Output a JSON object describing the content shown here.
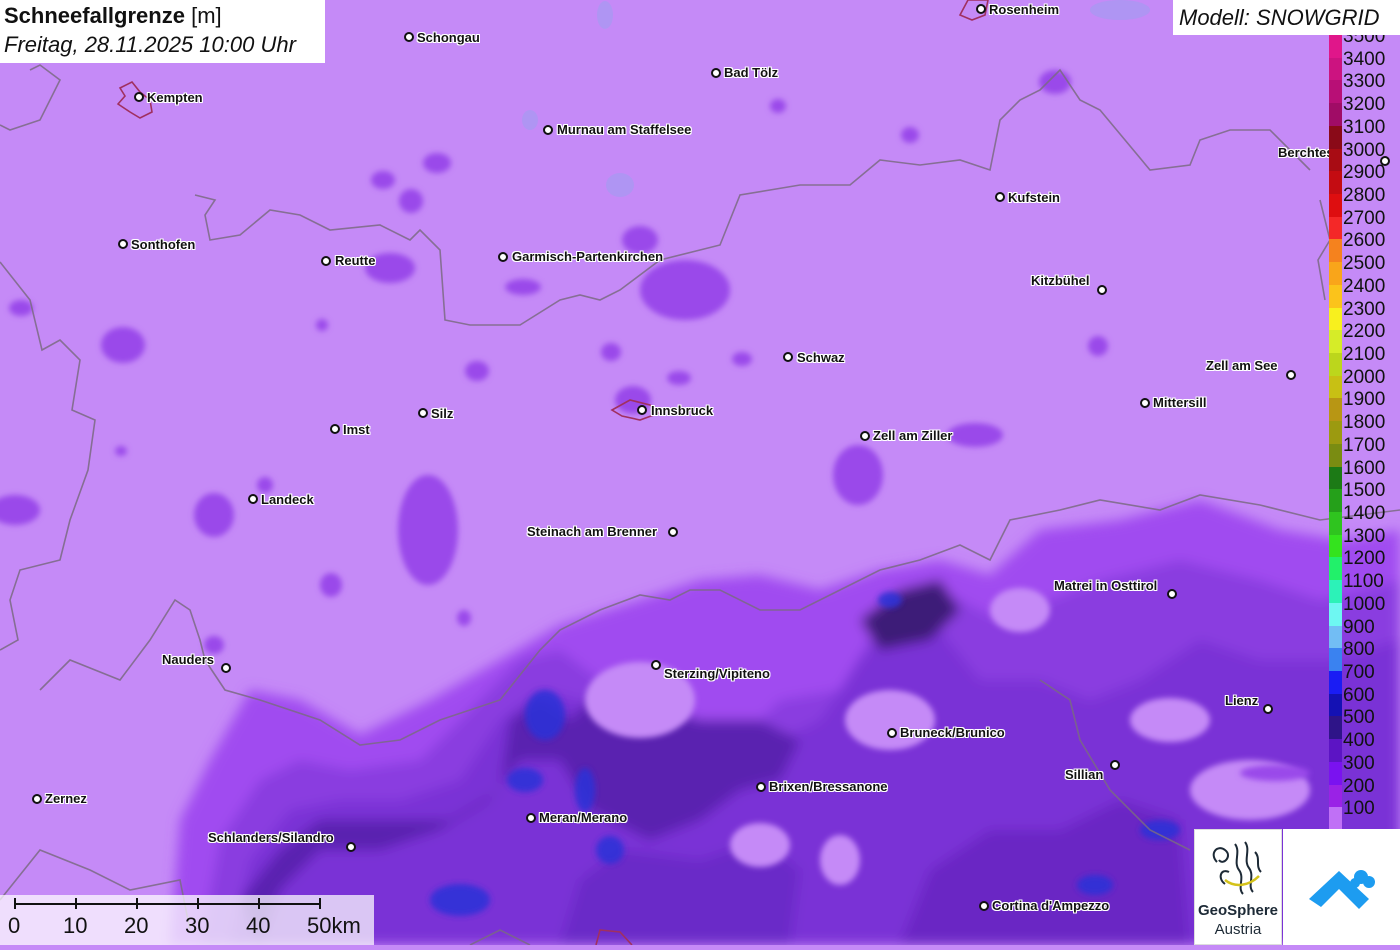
{
  "title": {
    "main": "Schneefallgrenze",
    "unit": "[m]",
    "datetime": "Freitag, 28.11.2025 10:00 Uhr"
  },
  "model": "Modell: SNOWGRID",
  "legend": {
    "items": [
      {
        "label": "3500",
        "color": "#e0168a"
      },
      {
        "label": "3400",
        "color": "#cc1380"
      },
      {
        "label": "3300",
        "color": "#b80f76"
      },
      {
        "label": "3200",
        "color": "#a00c66"
      },
      {
        "label": "3100",
        "color": "#8a0a18"
      },
      {
        "label": "3000",
        "color": "#a80c14"
      },
      {
        "label": "2900",
        "color": "#c40c12"
      },
      {
        "label": "2800",
        "color": "#de0e10"
      },
      {
        "label": "2700",
        "color": "#f42828"
      },
      {
        "label": "2600",
        "color": "#f5821e"
      },
      {
        "label": "2500",
        "color": "#f9a51a"
      },
      {
        "label": "2400",
        "color": "#fbc31b"
      },
      {
        "label": "2300",
        "color": "#f8f01e"
      },
      {
        "label": "2200",
        "color": "#d6ec28"
      },
      {
        "label": "2100",
        "color": "#bcd61c"
      },
      {
        "label": "2000",
        "color": "#c8c014"
      },
      {
        "label": "1900",
        "color": "#b89614"
      },
      {
        "label": "1800",
        "color": "#9c9a10"
      },
      {
        "label": "1700",
        "color": "#7a8c12"
      },
      {
        "label": "1600",
        "color": "#1c7a16"
      },
      {
        "label": "1500",
        "color": "#25a01a"
      },
      {
        "label": "1400",
        "color": "#2fc41f"
      },
      {
        "label": "1300",
        "color": "#34e31e"
      },
      {
        "label": "1200",
        "color": "#22f06a"
      },
      {
        "label": "1100",
        "color": "#2cf2b8"
      },
      {
        "label": "1000",
        "color": "#6ef7f2"
      },
      {
        "label": "900",
        "color": "#72bdf4"
      },
      {
        "label": "800",
        "color": "#3a82f0"
      },
      {
        "label": "700",
        "color": "#1a1cf4"
      },
      {
        "label": "600",
        "color": "#1411b4"
      },
      {
        "label": "500",
        "color": "#2e1488"
      },
      {
        "label": "400",
        "color": "#5c14c4"
      },
      {
        "label": "300",
        "color": "#7a12f0"
      },
      {
        "label": "200",
        "color": "#9a22e6"
      },
      {
        "label": "100",
        "color": "#c070f6"
      }
    ]
  },
  "cities": [
    {
      "name": "Rosenheim"
    },
    {
      "name": "Schongau"
    },
    {
      "name": "Kempten"
    },
    {
      "name": "Bad Tölz"
    },
    {
      "name": "Murnau am Staffelsee"
    },
    {
      "name": "Berchtesgaden"
    },
    {
      "name": "Kufstein"
    },
    {
      "name": "Sonthofen"
    },
    {
      "name": "Reutte"
    },
    {
      "name": "Garmisch-Partenkirchen"
    },
    {
      "name": "Kitzbühel"
    },
    {
      "name": "Schwaz"
    },
    {
      "name": "Zell am See"
    },
    {
      "name": "Innsbruck"
    },
    {
      "name": "Mittersill"
    },
    {
      "name": "Silz"
    },
    {
      "name": "Imst"
    },
    {
      "name": "Zell am Ziller"
    },
    {
      "name": "Landeck"
    },
    {
      "name": "Steinach am Brenner"
    },
    {
      "name": "Matrei in Osttirol"
    },
    {
      "name": "Nauders"
    },
    {
      "name": "Sterzing/Vipiteno"
    },
    {
      "name": "Lienz"
    },
    {
      "name": "Bruneck/Brunico"
    },
    {
      "name": "Sillian"
    },
    {
      "name": "Brixen/Bressanone"
    },
    {
      "name": "Zernez"
    },
    {
      "name": "Meran/Merano"
    },
    {
      "name": "Schlanders/Silandro"
    },
    {
      "name": "Cortina d'Ampezzo"
    }
  ],
  "scale_bar": {
    "labels": [
      "0",
      "10",
      "20",
      "30",
      "40",
      "50km"
    ]
  },
  "logos": {
    "geosphere_line1": "GeoSphere",
    "geosphere_line2": "Austria"
  }
}
